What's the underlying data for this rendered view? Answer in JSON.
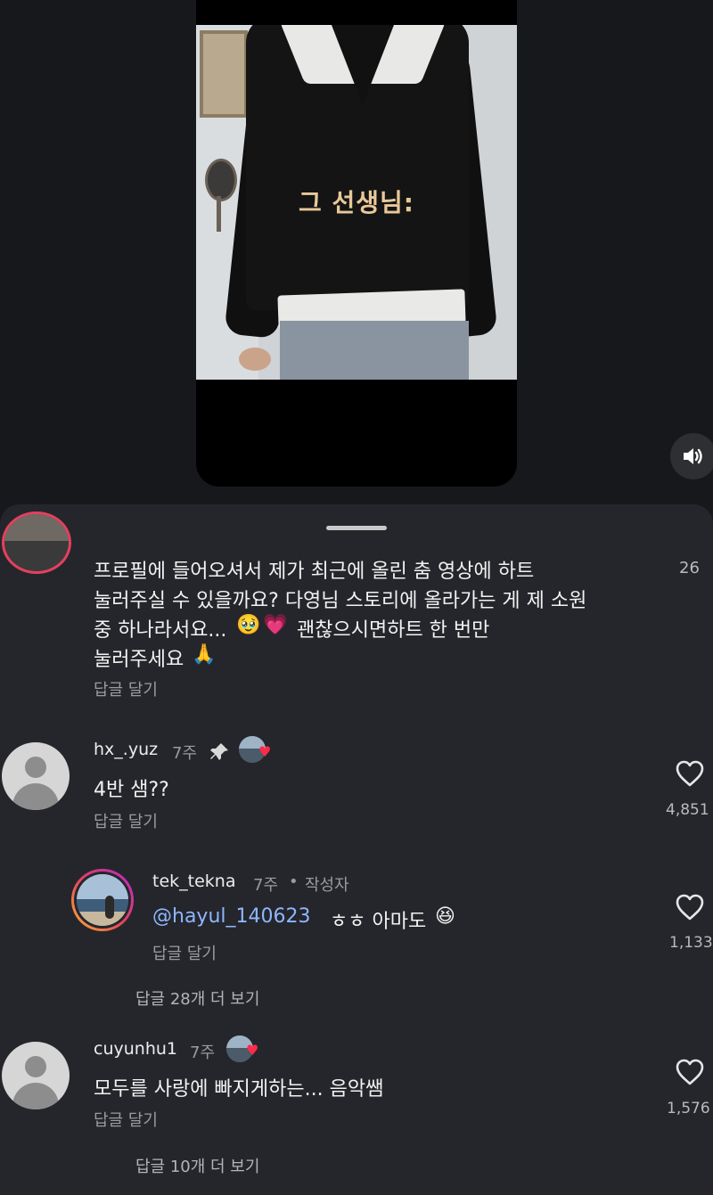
{
  "video": {
    "caption": "그 선생님:"
  },
  "colors": {
    "background": "#16181c",
    "sheet": "#25262b",
    "mention": "#8fb6ff",
    "caption": "#e8c89a",
    "liked_heart": "#ff2a4b"
  },
  "comments": {
    "c0": {
      "line1": "프로필에 들어오셔서 제가 최근에 올린 춤 영상에 하트",
      "line2": "눌러주실 수 있을까요? 다영님 스토리에 올라가는 게 제 소원",
      "line3": "중 하나라서요...",
      "line3_emoji1": "🥹",
      "line3_emoji2": "💗",
      "line3_rest": "괜찮으시면하트 한 번만",
      "line4": "눌러주세요",
      "line4_emoji": "🙏",
      "reply_label": "답글 달기",
      "likes": "26"
    },
    "c1": {
      "username": "hx_.yuz",
      "time": "7주",
      "pinned_icon": "pin-icon",
      "text": "4반 샘??",
      "reply_label": "답글 달기",
      "likes": "4,851",
      "liked_by_creator": true
    },
    "c1_reply": {
      "username": "tek_tekna",
      "time": "7주",
      "separator": "•",
      "author_tag": "작성자",
      "mention": "@hayul_140623",
      "text": "ㅎㅎ 아마도",
      "emoji": "😆",
      "reply_label": "답글 달기",
      "likes": "1,133"
    },
    "c1_view_replies": "답글 28개 더 보기",
    "c2": {
      "username": "cuyunhu1",
      "time": "7주",
      "text": "모두를 사랑에 빠지게하는... 음악쌤",
      "reply_label": "답글 달기",
      "likes": "1,576",
      "liked_by_creator": true
    },
    "c2_view_replies": "답글 10개 더 보기"
  },
  "icons": {
    "sound": "speaker-icon",
    "like": "heart-outline-icon",
    "pin": "pin-icon"
  }
}
